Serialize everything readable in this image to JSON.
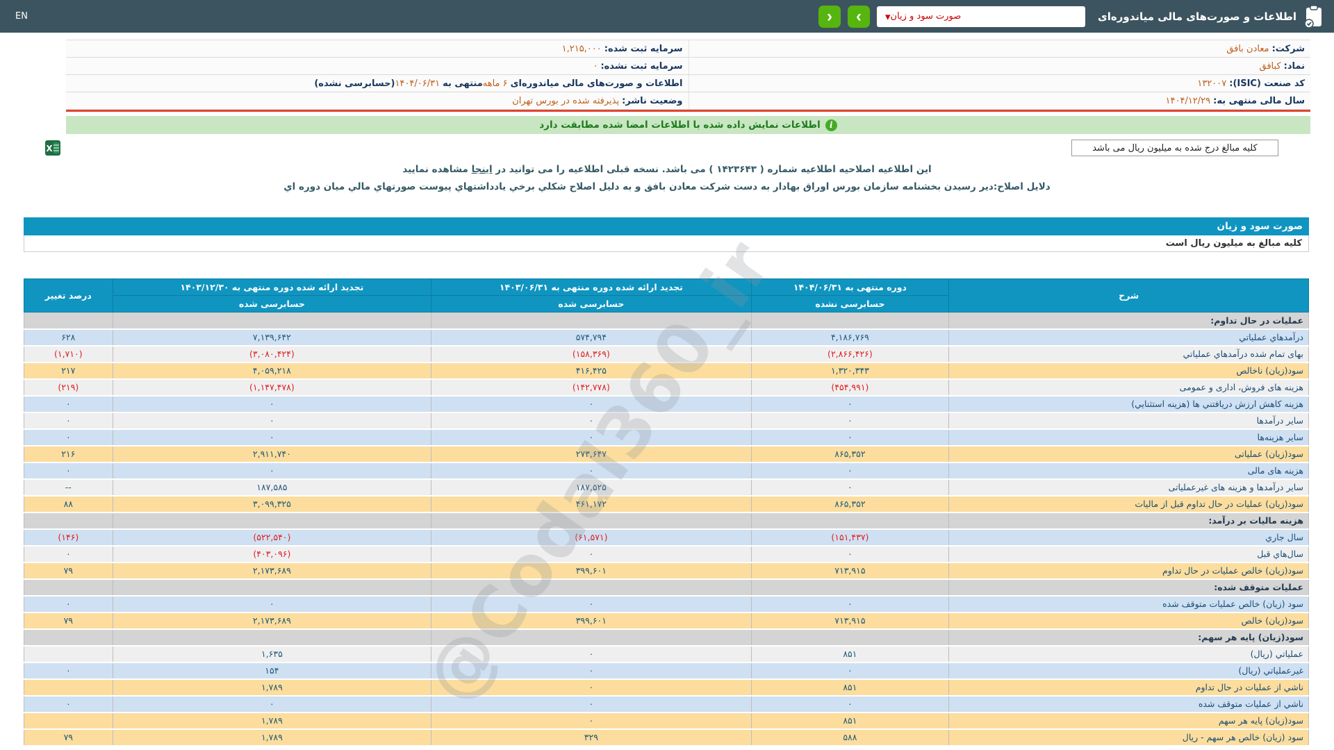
{
  "colors": {
    "topbar": "#3c545f",
    "accent_blue": "#1095c1",
    "button_green": "#56b50e",
    "banner_green": "#c9e6c3",
    "row_blue": "#cfe0f2",
    "row_gray": "#efeff0",
    "row_yellow": "#fcdd9d",
    "section_gray": "#d4d4d4",
    "negative_red": "#e01f1f",
    "value_orange": "#bf5e1a",
    "label_navy": "#17365d",
    "red_line": "#e0462e"
  },
  "topbar": {
    "title": "اطلاعات و صورت‌های مالی میاندوره‌ای",
    "dropdown_value": "صورت سود و زیان",
    "dropdown_chevron": "▾",
    "next_label": "›",
    "prev_label": "‹",
    "en_label": "EN"
  },
  "company_info": {
    "rows": [
      {
        "right": [
          {
            "t": "شرکت: ",
            "k": "l"
          },
          {
            "t": "معادن بافق",
            "k": "v"
          }
        ],
        "left": [
          {
            "t": "سرمایه ثبت شده: ",
            "k": "l"
          },
          {
            "t": "۱,۲۱۵,۰۰۰",
            "k": "v"
          }
        ]
      },
      {
        "right": [
          {
            "t": "نماد: ",
            "k": "l"
          },
          {
            "t": "کبافق",
            "k": "v"
          }
        ],
        "left": [
          {
            "t": "سرمایه ثبت نشده: ",
            "k": "l"
          },
          {
            "t": "۰",
            "k": "v"
          }
        ]
      },
      {
        "right": [
          {
            "t": "کد صنعت (ISIC): ",
            "k": "l"
          },
          {
            "t": "۱۳۲۰۰۷",
            "k": "v"
          }
        ],
        "left": [
          {
            "t": "اطلاعات و صورت‌های مالی میاندوره‌ای ",
            "k": "l"
          },
          {
            "t": "۶ ماهه",
            "k": "v"
          },
          {
            "t": " منتهی به ",
            "k": "l"
          },
          {
            "t": "۱۴۰۴/۰۶/۳۱",
            "k": "v"
          },
          {
            "t": "(حسابرسی نشده)",
            "k": "l"
          }
        ]
      },
      {
        "right": [
          {
            "t": "سال مالی منتهی به: ",
            "k": "l"
          },
          {
            "t": "۱۴۰۴/۱۲/۲۹",
            "k": "v"
          }
        ],
        "left": [
          {
            "t": "وضعیت ناشر: ",
            "k": "l"
          },
          {
            "t": "پذیرفته شده در بورس تهران",
            "k": "v"
          }
        ]
      }
    ]
  },
  "banner": {
    "text": "اطلاعات نمایش داده شده با اطلاعات امضا شده مطابقت دارد",
    "icon": "i"
  },
  "million_note": "کلیه مبالغ درج شده به میلیون ریال می باشد",
  "notices": {
    "line1_before": "این اطلاعیه اصلاحیه اطلاعیه شماره ( ۱۴۲۳۶۴۳ ) می باشد. نسخه قبلی اطلاعیه را می توانید در ",
    "line1_link": "اینجا",
    "line1_after": " مشاهده نمایید",
    "line2": "دلایل اصلاح:دیر رسیدن بخشنامه سازمان بورس اوراق بهادار به دست شرکت معادن بافق و به دلیل اصلاح شکلي برخي یادداشتهاي پیوست صورتهاي مالي میان دوره اي"
  },
  "statement": {
    "section_title": "صورت سود و زیان",
    "unit_note": "کلیه مبالغ به میلیون ریال است"
  },
  "table": {
    "headers": {
      "description": "شرح",
      "period1_title": "دوره منتهی به ۱۴۰۴/۰۶/۳۱",
      "period1_sub": "حسابرسی نشده",
      "period2_title": "تجدید ارائه شده دوره منتهی به ۱۴۰۳/۰۶/۳۱",
      "period2_sub": "حسابرسی شده",
      "period3_title": "تجدید ارائه شده دوره منتهی به ۱۴۰۳/۱۲/۳۰",
      "period3_sub": "حسابرسی شده",
      "pct": "درصد تغییر"
    },
    "rows": [
      {
        "label": "عملیات در حال تداوم:",
        "v1": "",
        "v2": "",
        "v3": "",
        "pct": "",
        "type": "section"
      },
      {
        "label": "درآمدهاي عملیاتي",
        "v1": "۴,۱۸۶,۷۶۹",
        "v2": "۵۷۴,۷۹۴",
        "v3": "۷,۱۳۹,۶۴۲",
        "pct": "۶۲۸",
        "type": "blue"
      },
      {
        "label": "بهای تمام شده درآمدهاي عملیاتي",
        "v1": "(۲,۸۶۶,۴۲۶)",
        "v2": "(۱۵۸,۳۶۹)",
        "v3": "(۳,۰۸۰,۴۲۴)",
        "pct": "(۱,۷۱۰)",
        "type": "gray"
      },
      {
        "label": "سود(زیان) ناخالص",
        "v1": "۱,۳۲۰,۳۴۳",
        "v2": "۴۱۶,۴۲۵",
        "v3": "۴,۰۵۹,۲۱۸",
        "pct": "۲۱۷",
        "type": "yellow"
      },
      {
        "label": "هزینه های فروش، اداری و عمومی",
        "v1": "(۴۵۴,۹۹۱)",
        "v2": "(۱۴۲,۷۷۸)",
        "v3": "(۱,۱۴۷,۴۷۸)",
        "pct": "(۲۱۹)",
        "type": "gray"
      },
      {
        "label": "هزینه کاهش ارزش دریافتني ها (هزینه استثنایي)",
        "v1": "۰",
        "v2": "۰",
        "v3": "۰",
        "pct": "۰",
        "type": "blue"
      },
      {
        "label": "سایر درآمدها",
        "v1": "۰",
        "v2": "۰",
        "v3": "۰",
        "pct": "۰",
        "type": "gray"
      },
      {
        "label": "سایر هزینه‌ها",
        "v1": "۰",
        "v2": "۰",
        "v3": "۰",
        "pct": "۰",
        "type": "blue"
      },
      {
        "label": "سود(زیان) عملیاتی",
        "v1": "۸۶۵,۳۵۲",
        "v2": "۲۷۳,۶۴۷",
        "v3": "۲,۹۱۱,۷۴۰",
        "pct": "۲۱۶",
        "type": "yellow"
      },
      {
        "label": "هزینه های مالی",
        "v1": "۰",
        "v2": "۰",
        "v3": "۰",
        "pct": "۰",
        "type": "blue"
      },
      {
        "label": "سایر درآمدها و هزینه های غیرعملیاتی",
        "v1": "۰",
        "v2": "۱۸۷,۵۲۵",
        "v3": "۱۸۷,۵۸۵",
        "pct": "--",
        "type": "gray"
      },
      {
        "label": "سود(زیان) عملیات در حال تداوم قبل از مالیات",
        "v1": "۸۶۵,۳۵۲",
        "v2": "۴۶۱,۱۷۲",
        "v3": "۳,۰۹۹,۳۲۵",
        "pct": "۸۸",
        "type": "yellow"
      },
      {
        "label": "هزینه مالیات بر درآمد:",
        "v1": "",
        "v2": "",
        "v3": "",
        "pct": "",
        "type": "section"
      },
      {
        "label": "سال جاري",
        "v1": "(۱۵۱,۴۳۷)",
        "v2": "(۶۱,۵۷۱)",
        "v3": "(۵۲۲,۵۴۰)",
        "pct": "(۱۴۶)",
        "type": "blue"
      },
      {
        "label": "سال‌هاي قبل",
        "v1": "۰",
        "v2": "۰",
        "v3": "(۴۰۳,۰۹۶)",
        "pct": "۰",
        "type": "gray"
      },
      {
        "label": "سود(زیان) خالص عملیات در حال تداوم",
        "v1": "۷۱۳,۹۱۵",
        "v2": "۳۹۹,۶۰۱",
        "v3": "۲,۱۷۳,۶۸۹",
        "pct": "۷۹",
        "type": "yellow"
      },
      {
        "label": "عملیات متوقف شده:",
        "v1": "",
        "v2": "",
        "v3": "",
        "pct": "",
        "type": "section"
      },
      {
        "label": "سود (زیان) خالص عملیات متوقف شده",
        "v1": "۰",
        "v2": "۰",
        "v3": "۰",
        "pct": "۰",
        "type": "blue"
      },
      {
        "label": "سود(زیان) خالص",
        "v1": "۷۱۳,۹۱۵",
        "v2": "۳۹۹,۶۰۱",
        "v3": "۲,۱۷۳,۶۸۹",
        "pct": "۷۹",
        "type": "yellow"
      },
      {
        "label": "سود(زیان) پایه هر سهم:",
        "v1": "",
        "v2": "",
        "v3": "",
        "pct": "",
        "type": "section"
      },
      {
        "label": "عملیاتي (ریال)",
        "v1": "۸۵۱",
        "v2": "۰",
        "v3": "۱,۶۳۵",
        "pct": "",
        "type": "gray"
      },
      {
        "label": "غیرعملیاتي (ریال)",
        "v1": "۰",
        "v2": "۰",
        "v3": "۱۵۴",
        "pct": "۰",
        "type": "blue"
      },
      {
        "label": "ناشي از عملیات در حال تداوم",
        "v1": "۸۵۱",
        "v2": "۰",
        "v3": "۱,۷۸۹",
        "pct": "",
        "type": "yellow"
      },
      {
        "label": "ناشي از عملیات متوقف شده",
        "v1": "۰",
        "v2": "۰",
        "v3": "۰",
        "pct": "۰",
        "type": "blue"
      },
      {
        "label": "سود(زیان) پایه هر سهم",
        "v1": "۸۵۱",
        "v2": "۰",
        "v3": "۱,۷۸۹",
        "pct": "",
        "type": "yellow"
      },
      {
        "label": "سود (زیان) خالص هر سهم - ریال",
        "v1": "۵۸۸",
        "v2": "۳۲۹",
        "v3": "۱,۷۸۹",
        "pct": "۷۹",
        "type": "yellow"
      }
    ]
  },
  "watermark": "@Codal360_ir"
}
